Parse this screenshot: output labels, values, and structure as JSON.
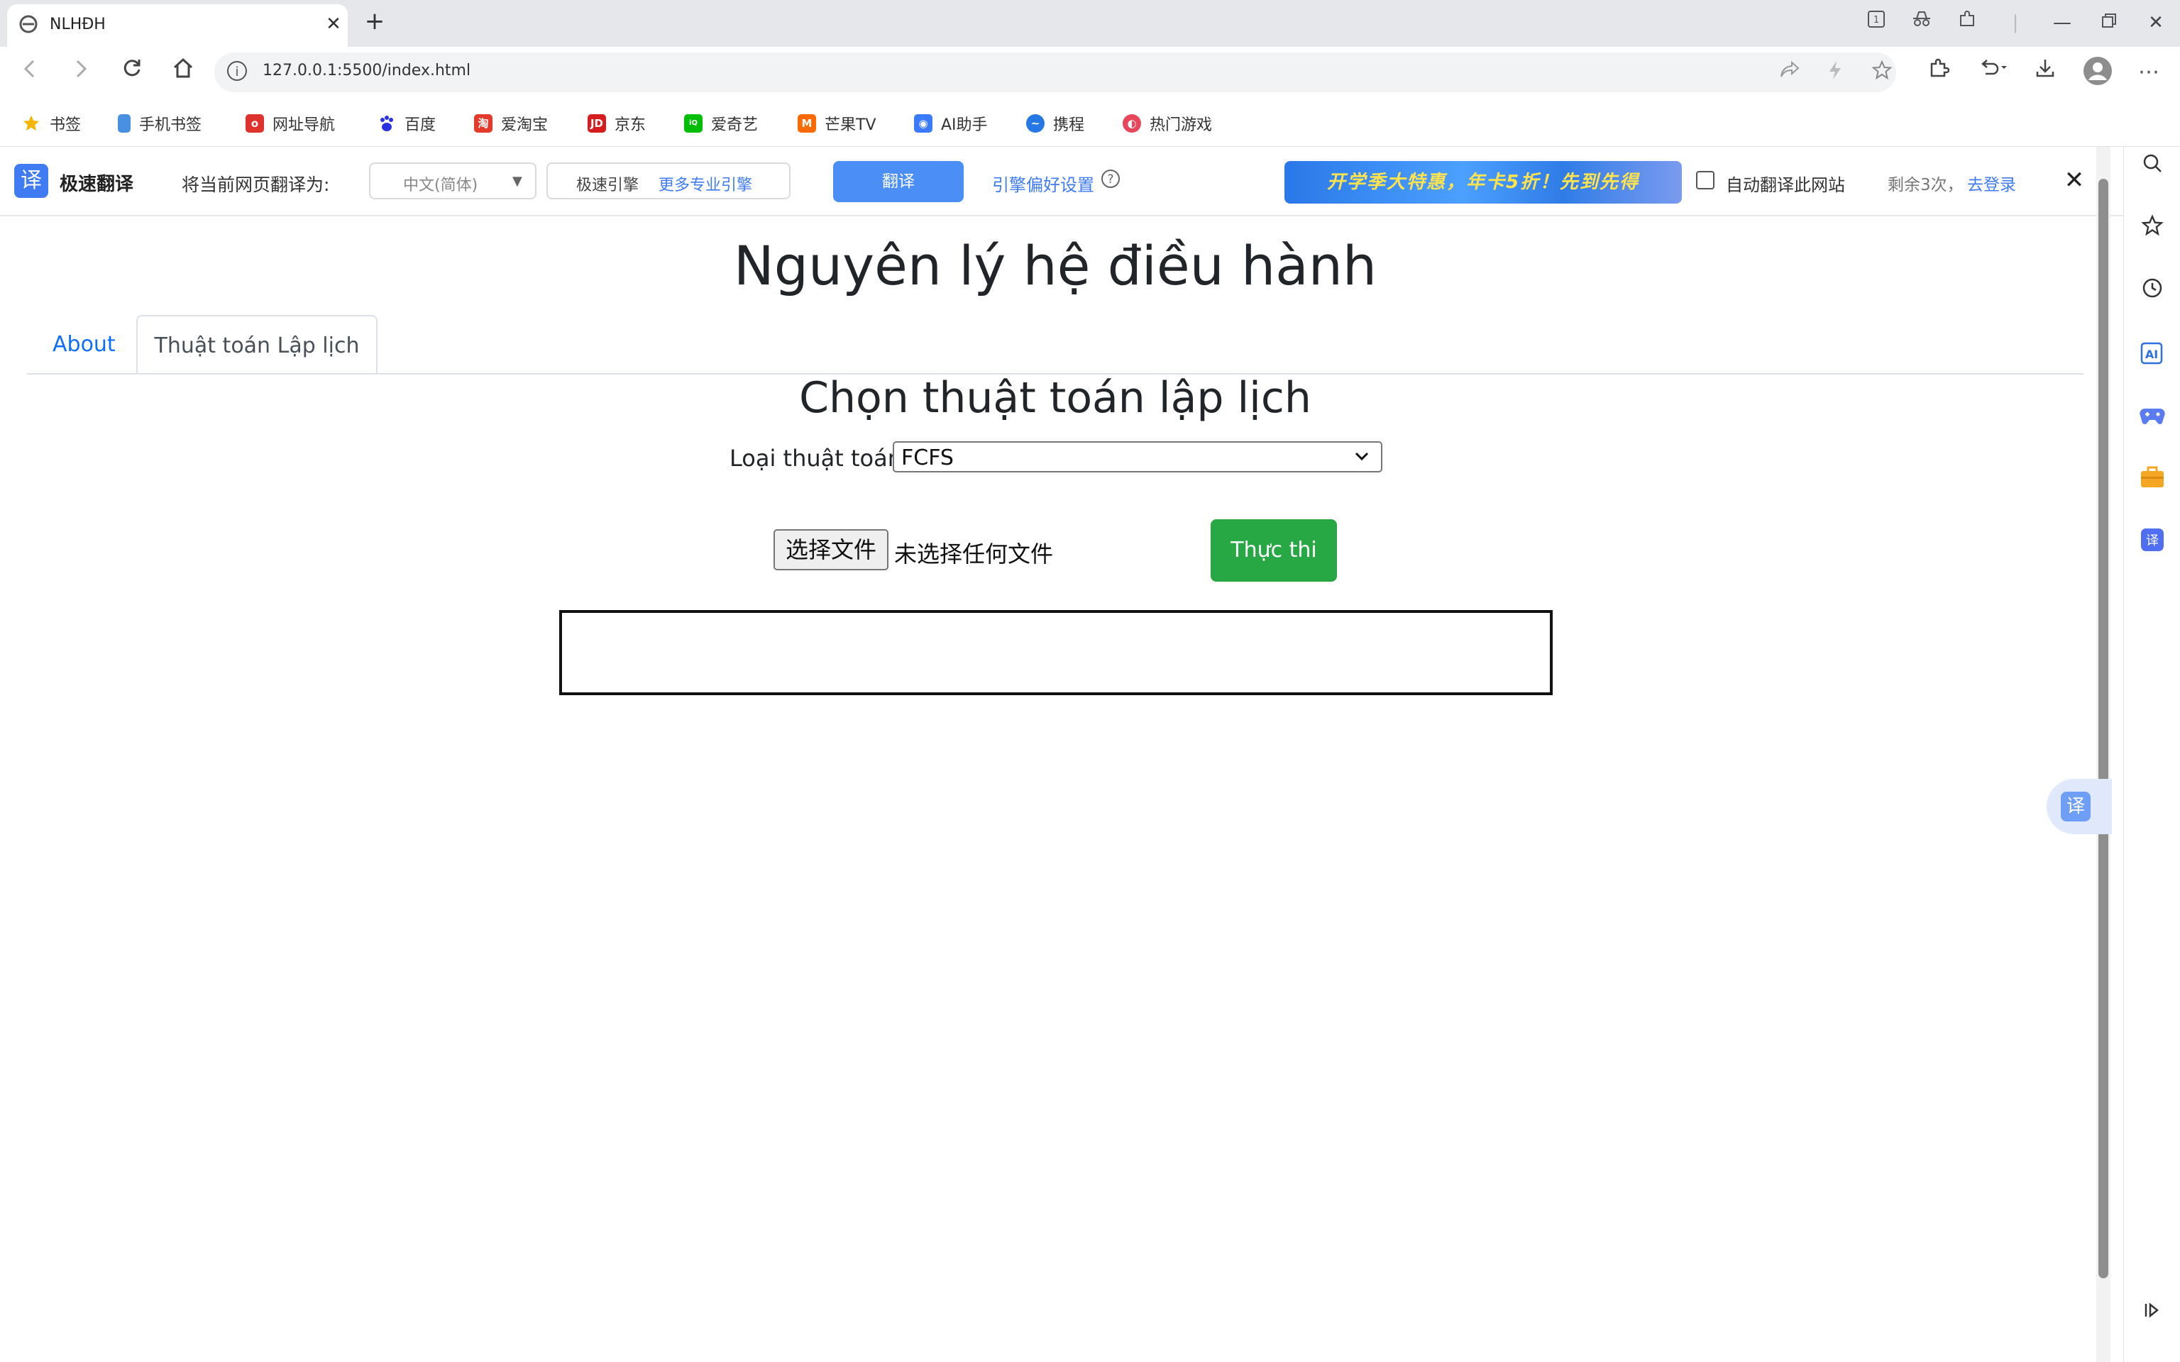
{
  "browser": {
    "tab_title": "NLHĐH",
    "tab_close": "✕",
    "new_tab": "+",
    "url": "127.0.0.1:5500/index.html",
    "bookmarks": [
      {
        "label": "书签",
        "icon": "star-icon",
        "color": "#f5b400"
      },
      {
        "label": "手机书签",
        "icon": "phone-icon",
        "color": "#4a90e2"
      },
      {
        "label": "网址导航",
        "icon": "nav-icon",
        "color": "#e0322d"
      },
      {
        "label": "百度",
        "icon": "baidu-icon",
        "color": "#2932e1"
      },
      {
        "label": "爱淘宝",
        "icon": "taobao-icon",
        "color": "#e4392b"
      },
      {
        "label": "京东",
        "icon": "jd-icon",
        "color": "#d71c1e"
      },
      {
        "label": "爱奇艺",
        "icon": "iqiyi-icon",
        "color": "#00be06"
      },
      {
        "label": "芒果TV",
        "icon": "mango-icon",
        "color": "#ff6a00"
      },
      {
        "label": "AI助手",
        "icon": "ai-icon",
        "color": "#3a7afe"
      },
      {
        "label": "携程",
        "icon": "ctrip-icon",
        "color": "#2577e3"
      },
      {
        "label": "热门游戏",
        "icon": "game-icon",
        "color": "#e8475b"
      }
    ]
  },
  "translate_bar": {
    "logo_glyph": "译",
    "name": "极速翻译",
    "label": "将当前网页翻译为:",
    "target_language": "中文(简体)",
    "engine": "极速引擎",
    "more_engines": "更多专业引擎",
    "translate_button": "翻译",
    "preferences": "引擎偏好设置",
    "help": "?",
    "banner_text": "开学季大特惠，年卡5折！先到先得",
    "auto_translate_label": "自动翻译此网站",
    "remaining": "剩余3次，",
    "login": "去登录",
    "close": "✕"
  },
  "page": {
    "title": "Nguyên lý hệ điều hành",
    "tabs": [
      {
        "label": "About",
        "active": false
      },
      {
        "label": "Thuật toán Lập lịch",
        "active": true
      }
    ],
    "section_title": "Chọn thuật toán lập lịch",
    "algorithm_label": "Loại thuật toán:",
    "algorithm_value": "FCFS",
    "file_button": "选择文件",
    "file_status": "未选择任何文件",
    "run_button": "Thực thi",
    "output": ""
  },
  "side_panel": {
    "icons": [
      "search-icon",
      "star-icon",
      "history-icon",
      "ai-icon",
      "gamepad-icon",
      "toolbox-icon",
      "translate-icon"
    ],
    "translate_glyph": "译"
  },
  "colors": {
    "accent_blue": "#3f7cf3",
    "run_green": "#28a745",
    "link_blue": "#0d6efd"
  }
}
